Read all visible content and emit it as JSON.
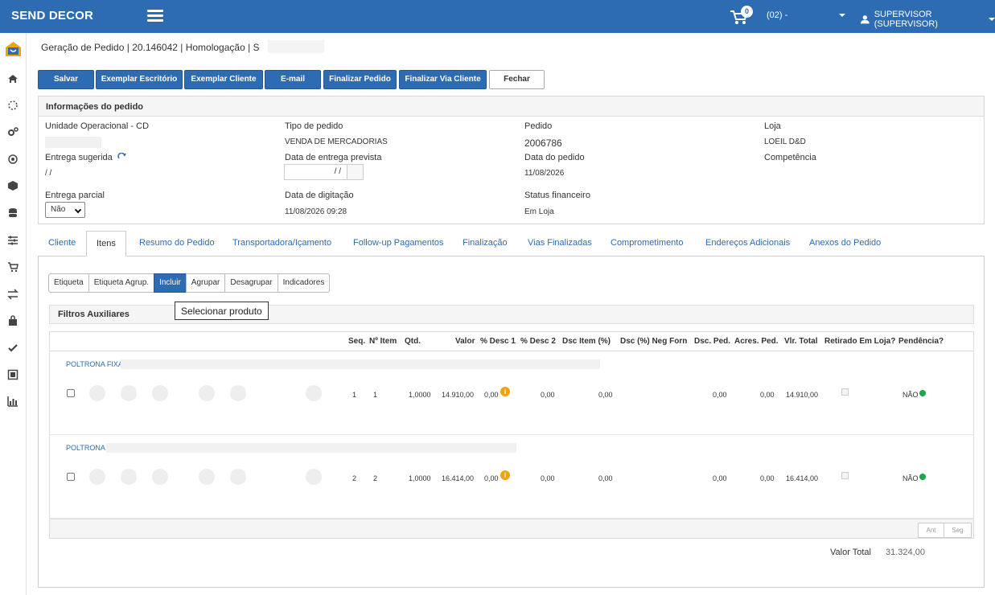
{
  "header": {
    "brand": "SEND DECOR",
    "cart_count": "0",
    "store": "(02) -",
    "user": "SUPERVISOR (SUPERVISOR)"
  },
  "breadcrumb": "Geração de Pedido | 20.146042 | Homologação | S",
  "toolbar": {
    "salvar": "Salvar",
    "exemplar_escritorio": "Exemplar Escritório",
    "exemplar_cliente": "Exemplar Cliente",
    "email": "E-mail",
    "finalizar_pedido": "Finalizar Pedido",
    "finalizar_via_cliente": "Finalizar Via Cliente",
    "fechar": "Fechar"
  },
  "info": {
    "title": "Informações do pedido",
    "unidade_label": "Unidade Operacional - CD",
    "tipo_label": "Tipo de pedido",
    "tipo_value": "VENDA DE MERCADORIAS",
    "pedido_label": "Pedido",
    "pedido_value": "2006786",
    "loja_label": "Loja",
    "loja_value": "LOEIL D&D",
    "entrega_sugerida_label": "Entrega sugerida",
    "entrega_sugerida_value": "/ /",
    "data_entrega_label": "Data de entrega prevista",
    "data_entrega_value": "/ /",
    "data_pedido_label": "Data do pedido",
    "data_pedido_value": "11/08/2026",
    "competencia_label": "Competência",
    "entrega_parcial_label": "Entrega parcial",
    "entrega_parcial_value": "Não",
    "data_digitacao_label": "Data de digitação",
    "data_digitacao_value": "11/08/2026 09:28",
    "status_fin_label": "Status financeiro",
    "status_fin_value": "Em Loja"
  },
  "tabs": [
    "Cliente",
    "Itens",
    "Resumo do Pedido",
    "Transportadora/Içamento",
    "Follow-up Pagamentos",
    "Finalização",
    "Vias Finalizadas",
    "Comprometimento",
    "Endereços Adicionais",
    "Anexos do Pedido"
  ],
  "subtabs": [
    "Etiqueta",
    "Etiqueta Agrup.",
    "Incluir",
    "Agrupar",
    "Desagrupar",
    "Indicadores"
  ],
  "tooltip": "Selecionar produto",
  "filtros": "Filtros Auxiliares",
  "grid": {
    "headers": [
      "Seq.",
      "Nº Item",
      "Qtd.",
      "Valor",
      "% Desc 1",
      "% Desc 2",
      "Dsc Item (%)",
      "Dsc (%) Neg Forn",
      "Dsc. Ped.",
      "Acres. Ped.",
      "Vlr. Total",
      "Retirado Em Loja?",
      "Pendência?"
    ],
    "rows": [
      {
        "name": "POLTRONA FIXA",
        "seq": "1",
        "item": "1",
        "qtd": "1,0000",
        "valor": "14.910,00",
        "desc1": "0,00",
        "desc2": "0,00",
        "dsc_item": "0,00",
        "dsc_ped": "0,00",
        "acres": "0,00",
        "total": "14.910,00",
        "pendencia": "NÃO"
      },
      {
        "name": "POLTRONA",
        "seq": "2",
        "item": "2",
        "qtd": "1,0000",
        "valor": "16.414,00",
        "desc1": "0,00",
        "desc2": "0,00",
        "dsc_item": "0,00",
        "dsc_ped": "0,00",
        "acres": "0,00",
        "total": "16.414,00",
        "pendencia": "NÃO"
      }
    ],
    "pager_prev": "Ant",
    "pager_next": "Seg"
  },
  "totals": {
    "label": "Valor Total",
    "value": "31.324,00"
  },
  "colors": {
    "primary": "#2d6bb3",
    "status_ok": "#1aa84b",
    "info": "#f0a30a"
  }
}
